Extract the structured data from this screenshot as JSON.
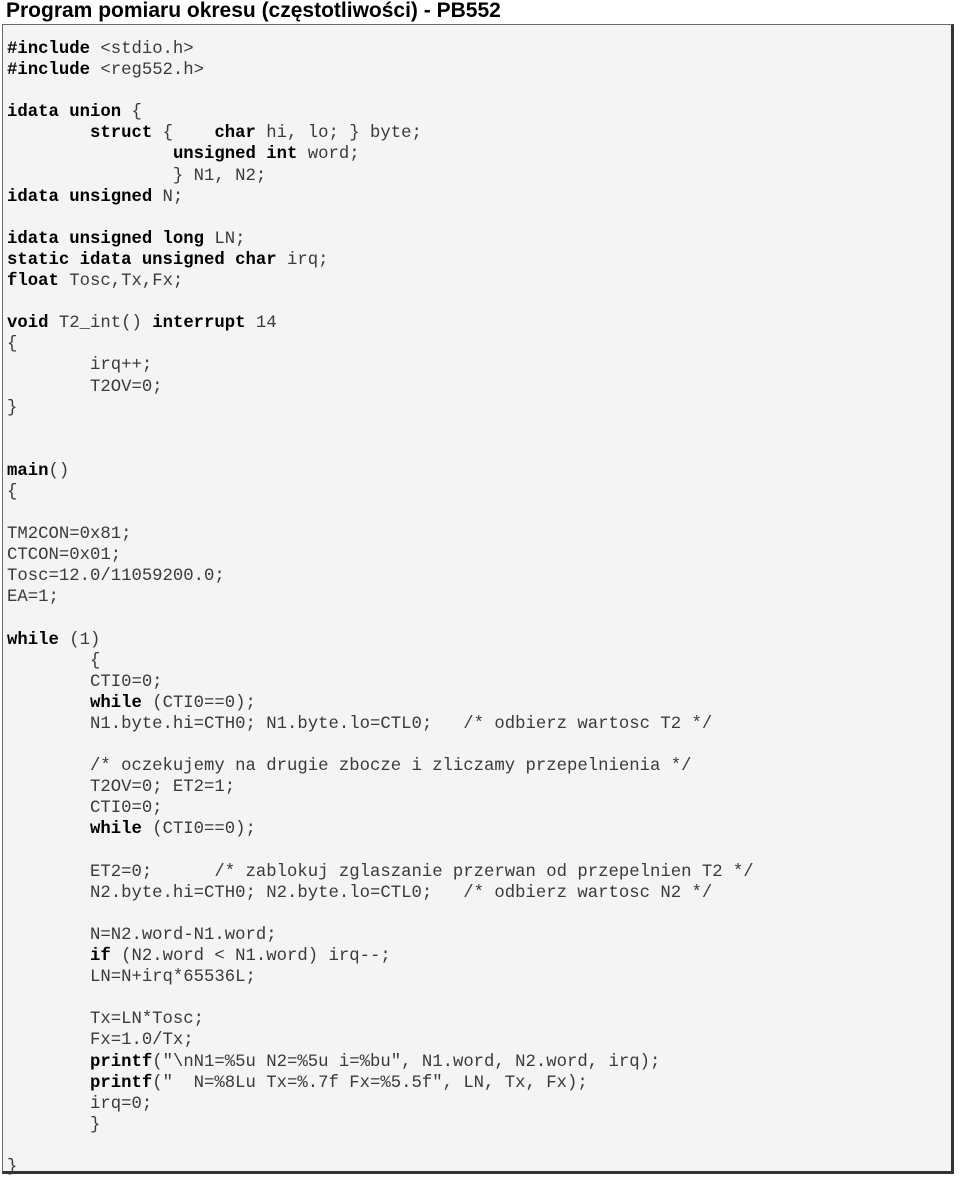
{
  "title": "Program pomiaru okresu (częstotliwości) - PB552",
  "code_lines": [
    [
      [
        "kw",
        "#include"
      ],
      [
        "t",
        " <stdio.h>"
      ]
    ],
    [
      [
        "kw",
        "#include"
      ],
      [
        "t",
        " <reg552.h>"
      ]
    ],
    [],
    [
      [
        "kw",
        "idata union"
      ],
      [
        "t",
        " {"
      ]
    ],
    [
      [
        "t",
        "        "
      ],
      [
        "kw",
        "struct"
      ],
      [
        "t",
        " {    "
      ],
      [
        "kw",
        "char"
      ],
      [
        "t",
        " hi, lo; } byte;"
      ]
    ],
    [
      [
        "t",
        "                "
      ],
      [
        "kw",
        "unsigned int"
      ],
      [
        "t",
        " word;"
      ]
    ],
    [
      [
        "t",
        "                } N1, N2;"
      ]
    ],
    [
      [
        "kw",
        "idata unsigned"
      ],
      [
        "t",
        " N;"
      ]
    ],
    [],
    [
      [
        "kw",
        "idata unsigned long"
      ],
      [
        "t",
        " LN;"
      ]
    ],
    [
      [
        "kw",
        "static idata unsigned char"
      ],
      [
        "t",
        " irq;"
      ]
    ],
    [
      [
        "kw",
        "float"
      ],
      [
        "t",
        " Tosc,Tx,Fx;"
      ]
    ],
    [],
    [
      [
        "kw",
        "void"
      ],
      [
        "t",
        " T2_int() "
      ],
      [
        "kw",
        "interrupt"
      ],
      [
        "t",
        " 14"
      ]
    ],
    [
      [
        "t",
        "{"
      ]
    ],
    [
      [
        "t",
        "        irq++;"
      ]
    ],
    [
      [
        "t",
        "        T2OV=0;"
      ]
    ],
    [
      [
        "t",
        "}"
      ]
    ],
    [],
    [],
    [
      [
        "kw",
        "main"
      ],
      [
        "t",
        "()"
      ]
    ],
    [
      [
        "t",
        "{"
      ]
    ],
    [],
    [
      [
        "t",
        "TM2CON=0x81;"
      ]
    ],
    [
      [
        "t",
        "CTCON=0x01;"
      ]
    ],
    [
      [
        "t",
        "Tosc=12.0/11059200.0;"
      ]
    ],
    [
      [
        "t",
        "EA=1;"
      ]
    ],
    [],
    [
      [
        "kw",
        "while"
      ],
      [
        "t",
        " (1)"
      ]
    ],
    [
      [
        "t",
        "        {"
      ]
    ],
    [
      [
        "t",
        "        CTI0=0;"
      ]
    ],
    [
      [
        "t",
        "        "
      ],
      [
        "kw",
        "while"
      ],
      [
        "t",
        " (CTI0==0);"
      ]
    ],
    [
      [
        "t",
        "        N1.byte.hi=CTH0; N1.byte.lo=CTL0;   /* odbierz wartosc T2 */"
      ]
    ],
    [],
    [
      [
        "t",
        "        /* oczekujemy na drugie zbocze i zliczamy przepelnienia */"
      ]
    ],
    [
      [
        "t",
        "        T2OV=0; ET2=1;"
      ]
    ],
    [
      [
        "t",
        "        CTI0=0;"
      ]
    ],
    [
      [
        "t",
        "        "
      ],
      [
        "kw",
        "while"
      ],
      [
        "t",
        " (CTI0==0);"
      ]
    ],
    [],
    [
      [
        "t",
        "        ET2=0;      /* zablokuj zglaszanie przerwan od przepelnien T2 */"
      ]
    ],
    [
      [
        "t",
        "        N2.byte.hi=CTH0; N2.byte.lo=CTL0;   /* odbierz wartosc N2 */"
      ]
    ],
    [],
    [
      [
        "t",
        "        N=N2.word-N1.word;"
      ]
    ],
    [
      [
        "t",
        "        "
      ],
      [
        "kw",
        "if"
      ],
      [
        "t",
        " (N2.word < N1.word) irq--;"
      ]
    ],
    [
      [
        "t",
        "        LN=N+irq*65536L;"
      ]
    ],
    [],
    [
      [
        "t",
        "        Tx=LN*Tosc;"
      ]
    ],
    [
      [
        "t",
        "        Fx=1.0/Tx;"
      ]
    ],
    [
      [
        "t",
        "        "
      ],
      [
        "kw",
        "printf"
      ],
      [
        "t",
        "(\"\\nN1=%5u N2=%5u i=%bu\", N1.word, N2.word, irq);"
      ]
    ],
    [
      [
        "t",
        "        "
      ],
      [
        "kw",
        "printf"
      ],
      [
        "t",
        "(\"  N=%8Lu Tx=%.7f Fx=%5.5f\", LN, Tx, Fx);"
      ]
    ],
    [
      [
        "t",
        "        irq=0;"
      ]
    ],
    [
      [
        "t",
        "        }"
      ]
    ],
    [],
    [
      [
        "t",
        "}"
      ]
    ]
  ]
}
